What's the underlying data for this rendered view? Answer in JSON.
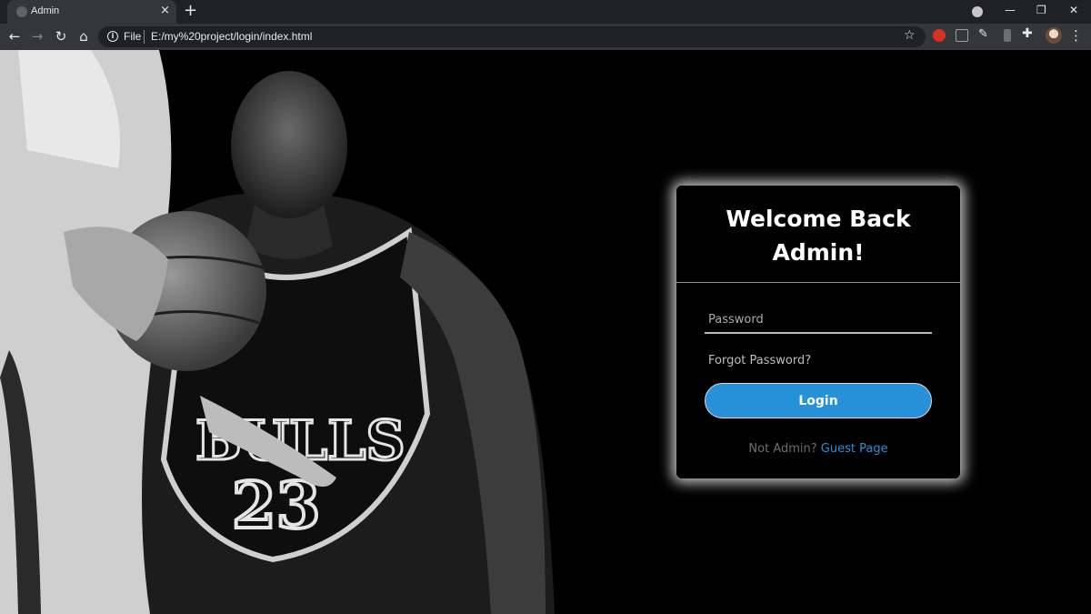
{
  "browser": {
    "tab_title": "Admin",
    "tab_close": "×",
    "new_tab": "+",
    "window_controls": {
      "minimize": "—",
      "restore": "❐",
      "close": "✕"
    },
    "scheme_label": "File",
    "url": "E:/my%20project/login/index.html",
    "icons": [
      "back-icon",
      "forward-icon",
      "reload-icon",
      "home-icon",
      "info-icon",
      "star-icon",
      "extension-icon",
      "puzzle-icon",
      "avatar",
      "menu-icon"
    ]
  },
  "login_card": {
    "title_line1": "Welcome Back",
    "title_line2": "Admin!",
    "password_placeholder": "Password",
    "forgot_label": "Forgot Password?",
    "login_label": "Login",
    "not_admin_text": "Not Admin?",
    "guest_link_label": "Guest Page"
  },
  "colors": {
    "accent": "#2691d9",
    "page_background": "#000000",
    "chrome_dark": "#202124",
    "chrome_toolbar": "#35363a"
  }
}
